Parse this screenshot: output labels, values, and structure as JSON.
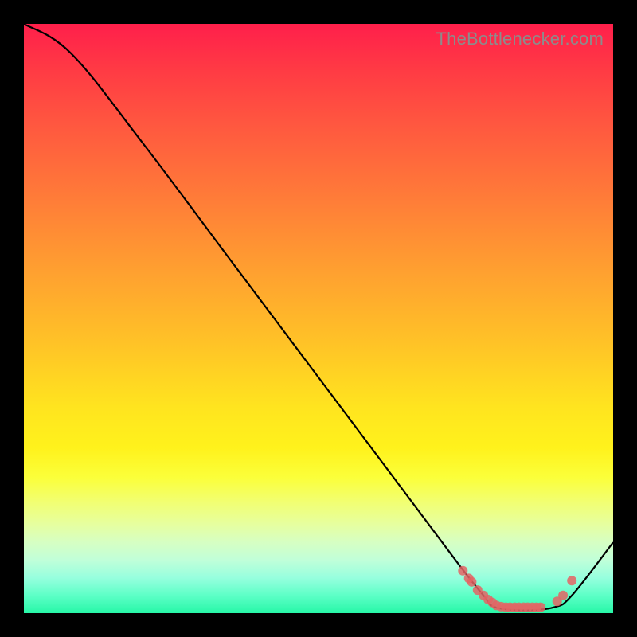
{
  "watermark": "TheBottlenecker.com",
  "chart_data": {
    "type": "line",
    "title": "",
    "xlabel": "",
    "ylabel": "",
    "xlim": [
      0,
      100
    ],
    "ylim": [
      0,
      100
    ],
    "x": [
      0,
      8,
      20,
      35,
      50,
      65,
      74,
      78,
      80,
      85,
      90,
      93,
      100
    ],
    "values": [
      100,
      95,
      80,
      60,
      40,
      20,
      8,
      3,
      1,
      0.5,
      1,
      3,
      12
    ],
    "marker_points_x": [
      74.5,
      75.5,
      76,
      77,
      78,
      78.8,
      79.5,
      80.2,
      81,
      81.8,
      82.5,
      83.3,
      84,
      84.8,
      85.5,
      86.3,
      87,
      87.7,
      90.5,
      91.5,
      93
    ],
    "marker_points_y": [
      7.2,
      5.9,
      5.3,
      3.9,
      3.0,
      2.3,
      1.8,
      1.3,
      1.1,
      1.0,
      1.0,
      1.0,
      1.0,
      1.0,
      1.0,
      1.0,
      1.0,
      1.0,
      2.0,
      3.0,
      5.5
    ],
    "colors": {
      "line": "#000000",
      "marker": "#e46464",
      "gradient_top": "#ff1f4b",
      "gradient_bottom": "#27f7a7"
    }
  }
}
